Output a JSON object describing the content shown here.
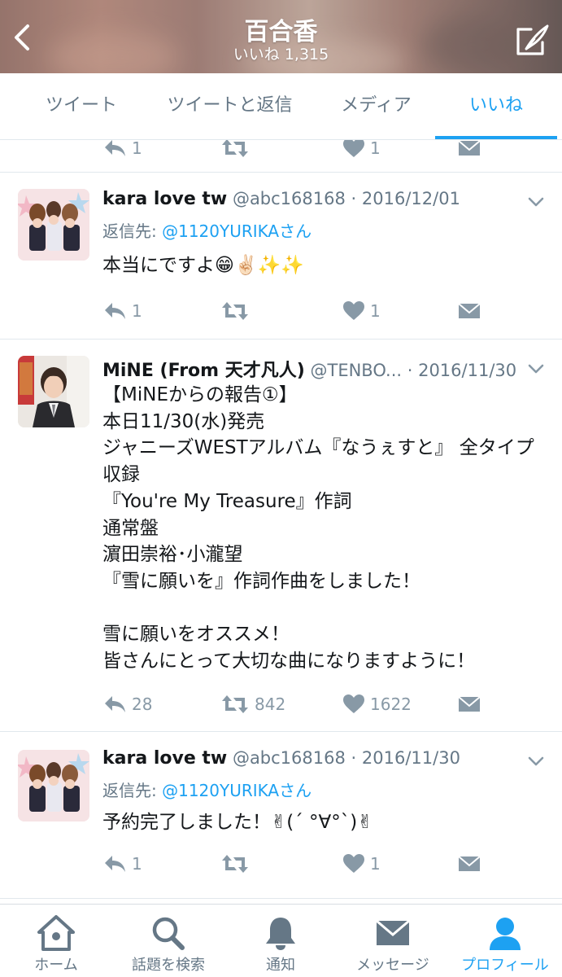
{
  "header": {
    "title": "百合香",
    "subtitle": "いいね 1,315"
  },
  "tabs": [
    {
      "label": "ツイート",
      "active": false
    },
    {
      "label": "ツイートと返信",
      "active": false
    },
    {
      "label": "メディア",
      "active": false
    },
    {
      "label": "いいね",
      "active": true
    }
  ],
  "partial_row": {
    "reply_count": "1",
    "like_count": "1"
  },
  "tweets": [
    {
      "name": "kara love tw",
      "handle": "@abc168168",
      "date": "· 2016/12/01",
      "reply_prefix": "返信先: ",
      "reply_handle": "@1120YURIKAさん",
      "body": "本当にですよ😁✌🏻✨✨",
      "replies": "1",
      "retweets": "",
      "likes": "1"
    },
    {
      "name": "MiNE (From 天才凡人)",
      "handle": "@TENBO...",
      "date": "· 2016/11/30",
      "body": "【MiNEからの報告①】\n本日11/30(水)発売\nジャニーズWESTアルバム『なうぇすと』 全タイプ収録\n『You're My Treasure』作詞\n通常盤\n濵田崇裕･小瀧望\n『雪に願いを』作詞作曲をしました！\n\n雪に願いをオススメ！\n皆さんにとって大切な曲になりますように！",
      "replies": "28",
      "retweets": "842",
      "likes": "1622"
    },
    {
      "name": "kara love tw",
      "handle": "@abc168168",
      "date": "· 2016/11/30",
      "reply_prefix": "返信先: ",
      "reply_handle": "@1120YURIKAさん",
      "body": "予約完了しました！✌︎(´ °∀°`)✌︎",
      "replies": "1",
      "retweets": "",
      "likes": "1"
    }
  ],
  "bottom_nav": [
    {
      "label": "ホーム",
      "icon": "home-icon",
      "active": false
    },
    {
      "label": "話題を検索",
      "icon": "search-icon",
      "active": false
    },
    {
      "label": "通知",
      "icon": "bell-icon",
      "active": false
    },
    {
      "label": "メッセージ",
      "icon": "envelope-icon",
      "active": false
    },
    {
      "label": "プロフィール",
      "icon": "person-icon",
      "active": true
    }
  ],
  "colors": {
    "accent": "#1da1f2",
    "muted": "#657786",
    "icon_gray": "#8899a6"
  }
}
